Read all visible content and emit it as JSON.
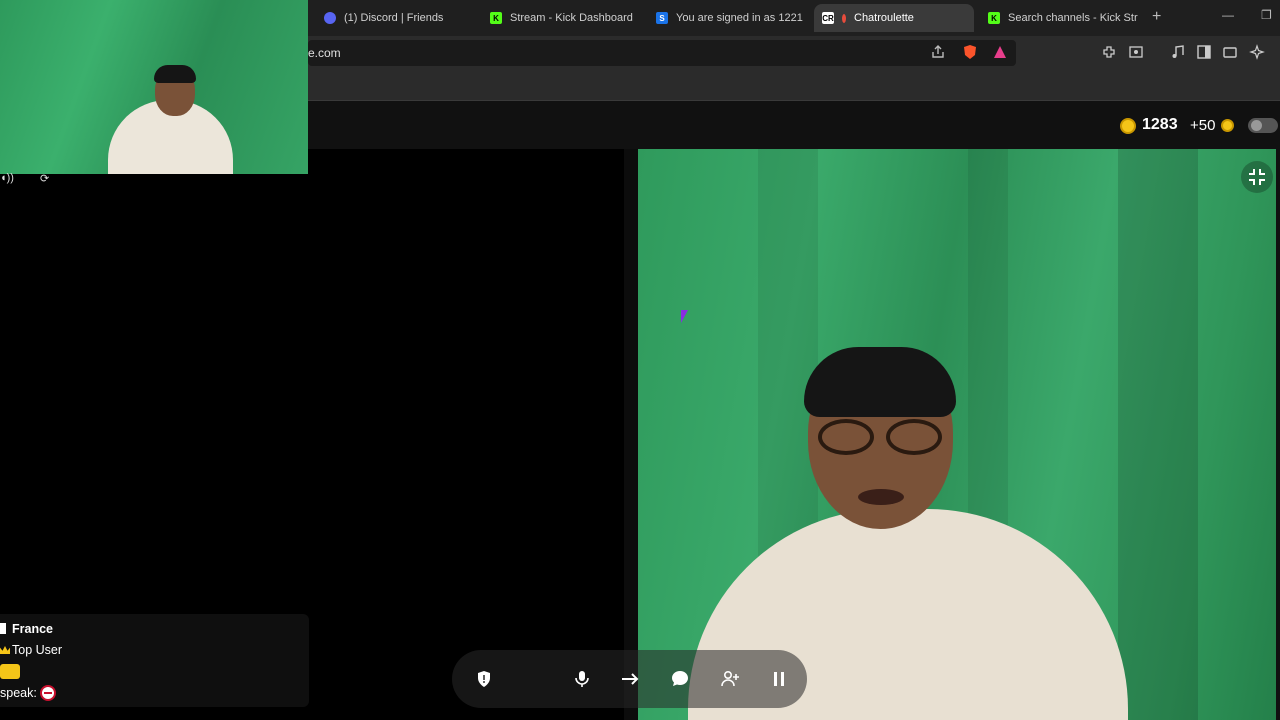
{
  "browser": {
    "tabs": [
      {
        "label": "(1) Discord | Friends",
        "icon": "discord-icon"
      },
      {
        "label": "Stream - Kick Dashboard",
        "icon": "kick-icon"
      },
      {
        "label": "You are signed in as 1221",
        "icon": "s-icon"
      },
      {
        "label": "Chatroulette",
        "icon": "chatroulette-icon",
        "active": true
      },
      {
        "label": "Search channels - Kick Str",
        "icon": "kick-icon"
      }
    ],
    "new_tab": "+",
    "close_tab": "✕",
    "url": "e.com"
  },
  "header": {
    "coins": "1283",
    "bonus": "+50"
  },
  "user_card": {
    "country": "France",
    "rank": "Top User",
    "speaks_label": "speak:"
  },
  "colors": {
    "accent_coin": "#f5c518",
    "background": "#000000",
    "green_screen": "#35a565"
  },
  "controls": [
    {
      "name": "report-shield-icon"
    },
    {
      "name": "microphone-icon"
    },
    {
      "name": "next-arrow-icon"
    },
    {
      "name": "chat-bubble-icon"
    },
    {
      "name": "add-friend-icon"
    },
    {
      "name": "pause-icon"
    }
  ]
}
